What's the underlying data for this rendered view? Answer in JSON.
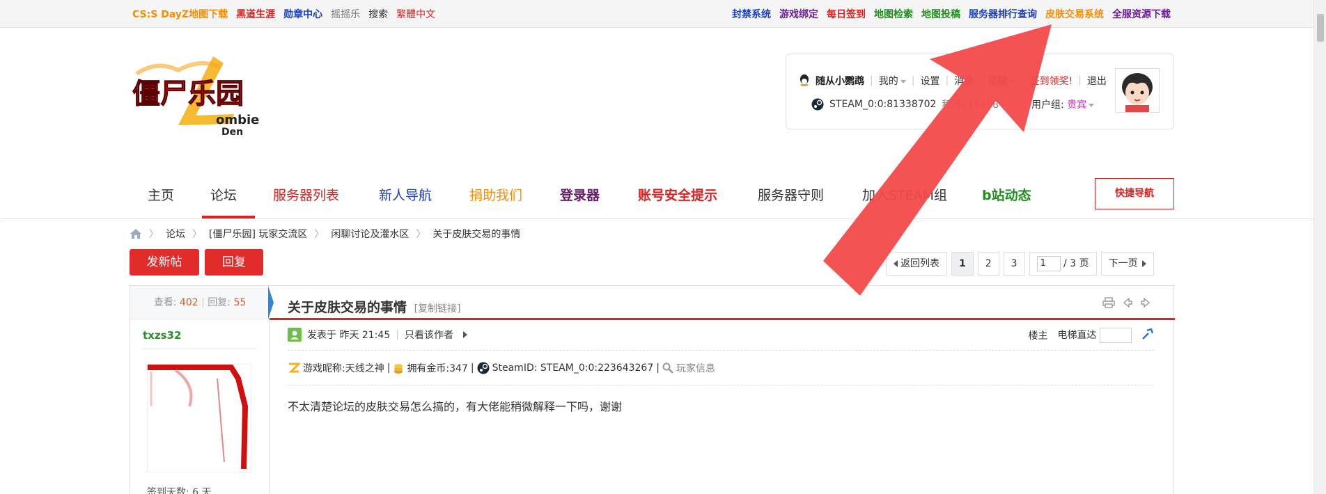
{
  "topbar": {
    "left_links": [
      {
        "label": "CS:S DayZ地图下载",
        "color": "#ff8c00"
      },
      {
        "label": "黑道生涯",
        "color": "#e02020"
      },
      {
        "label": "勋章中心",
        "color": "#1a3fbf"
      },
      {
        "label": "摇摇乐",
        "color": "#777777"
      },
      {
        "label": "搜索",
        "color": "#333333"
      },
      {
        "label": "繁體中文",
        "color": "#e02020"
      }
    ],
    "right_links": [
      {
        "label": "封禁系统",
        "color": "#1a3fbf"
      },
      {
        "label": "游戏绑定",
        "color": "#6a1b9a"
      },
      {
        "label": "每日签到",
        "color": "#e02020"
      },
      {
        "label": "地图检索",
        "color": "#1f8f1f"
      },
      {
        "label": "地图投稿",
        "color": "#1f8f1f"
      },
      {
        "label": "服务器排行查询",
        "color": "#1a3fbf"
      },
      {
        "label": "皮肤交易系统",
        "color": "#ff8c00"
      },
      {
        "label": "全服资源下载",
        "color": "#6a1b9a"
      }
    ]
  },
  "logo": {
    "text_main": "僵尸乐园",
    "text_sub1": "ombie",
    "text_sub2": "Den"
  },
  "user": {
    "name": "随从小鹦鹉",
    "links": [
      "我的",
      "设置",
      "消息",
      "提醒",
      "签到领奖!",
      "退出"
    ],
    "steam": "STEAM_0:0:81338702",
    "points_label": "积分: 14498",
    "group_label": "用户组:",
    "group_value": "贵宾"
  },
  "nav": {
    "items": [
      {
        "label": "主页",
        "color": "#333333",
        "bold": false
      },
      {
        "label": "论坛",
        "color": "#333333",
        "bold": false
      },
      {
        "label": "服务器列表",
        "color": "#e02020",
        "bold": false
      },
      {
        "label": "新人导航",
        "color": "#1a3fbf",
        "bold": false
      },
      {
        "label": "捐助我们",
        "color": "#ff8c00",
        "bold": false
      },
      {
        "label": "登录器",
        "color": "#6a1b6a",
        "bold": true
      },
      {
        "label": "账号安全提示",
        "color": "#e02020",
        "bold": true
      },
      {
        "label": "服务器守则",
        "color": "#333333",
        "bold": false
      },
      {
        "label": "加入STEAM组",
        "color": "#333333",
        "bold": false
      },
      {
        "label": "b站动态",
        "color": "#1f8f1f",
        "bold": true
      }
    ],
    "quick_nav": "快捷导航"
  },
  "breadcrumb": [
    "论坛",
    "[僵尸乐园] 玩家交流区",
    "闲聊讨论及灌水区",
    "关于皮肤交易的事情"
  ],
  "actions": {
    "new_thread": "发新帖",
    "reply": "回复"
  },
  "pager": {
    "back": "返回列表",
    "pages": [
      "1",
      "2",
      "3"
    ],
    "current_input": "1",
    "total": "/ 3 页",
    "next": "下一页"
  },
  "thread": {
    "views_label": "查看:",
    "views": "402",
    "replies_label": "回复:",
    "replies": "55",
    "title": "关于皮肤交易的事情",
    "copy_link": "[复制链接]",
    "author": "txzs32",
    "checkin": "签到天数: 6 天",
    "posted": "发表于 昨天 21:45",
    "only_author": "只看该作者",
    "floor": "楼主",
    "elevator": "电梯直达",
    "game_nick": "游戏昵称:天线之神",
    "gold": "拥有金币:347",
    "steam_id": "SteamID: STEAM_0:0:223643267",
    "player_info": "玩家信息",
    "content": "不太清楚论坛的皮肤交易怎么搞的，有大佬能稍微解释一下吗，谢谢"
  }
}
